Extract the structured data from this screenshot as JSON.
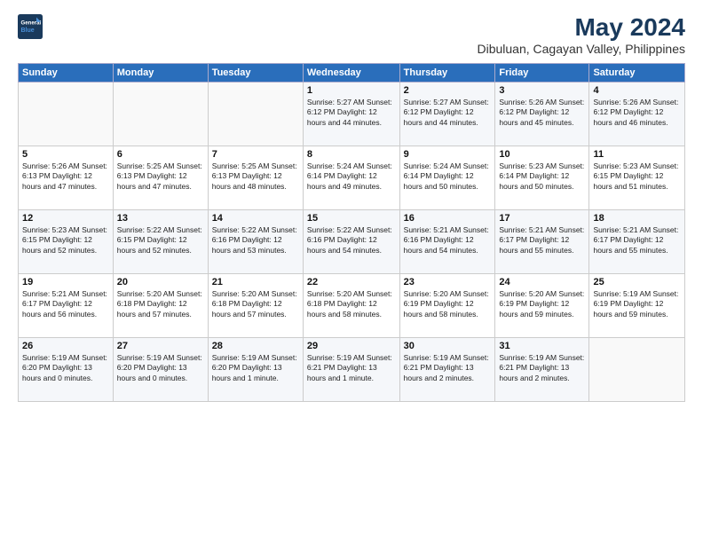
{
  "header": {
    "logo_line1": "General",
    "logo_line2": "Blue",
    "title": "May 2024",
    "subtitle": "Dibuluan, Cagayan Valley, Philippines"
  },
  "weekdays": [
    "Sunday",
    "Monday",
    "Tuesday",
    "Wednesday",
    "Thursday",
    "Friday",
    "Saturday"
  ],
  "weeks": [
    [
      {
        "day": "",
        "detail": ""
      },
      {
        "day": "",
        "detail": ""
      },
      {
        "day": "",
        "detail": ""
      },
      {
        "day": "1",
        "detail": "Sunrise: 5:27 AM\nSunset: 6:12 PM\nDaylight: 12 hours\nand 44 minutes."
      },
      {
        "day": "2",
        "detail": "Sunrise: 5:27 AM\nSunset: 6:12 PM\nDaylight: 12 hours\nand 44 minutes."
      },
      {
        "day": "3",
        "detail": "Sunrise: 5:26 AM\nSunset: 6:12 PM\nDaylight: 12 hours\nand 45 minutes."
      },
      {
        "day": "4",
        "detail": "Sunrise: 5:26 AM\nSunset: 6:12 PM\nDaylight: 12 hours\nand 46 minutes."
      }
    ],
    [
      {
        "day": "5",
        "detail": "Sunrise: 5:26 AM\nSunset: 6:13 PM\nDaylight: 12 hours\nand 47 minutes."
      },
      {
        "day": "6",
        "detail": "Sunrise: 5:25 AM\nSunset: 6:13 PM\nDaylight: 12 hours\nand 47 minutes."
      },
      {
        "day": "7",
        "detail": "Sunrise: 5:25 AM\nSunset: 6:13 PM\nDaylight: 12 hours\nand 48 minutes."
      },
      {
        "day": "8",
        "detail": "Sunrise: 5:24 AM\nSunset: 6:14 PM\nDaylight: 12 hours\nand 49 minutes."
      },
      {
        "day": "9",
        "detail": "Sunrise: 5:24 AM\nSunset: 6:14 PM\nDaylight: 12 hours\nand 50 minutes."
      },
      {
        "day": "10",
        "detail": "Sunrise: 5:23 AM\nSunset: 6:14 PM\nDaylight: 12 hours\nand 50 minutes."
      },
      {
        "day": "11",
        "detail": "Sunrise: 5:23 AM\nSunset: 6:15 PM\nDaylight: 12 hours\nand 51 minutes."
      }
    ],
    [
      {
        "day": "12",
        "detail": "Sunrise: 5:23 AM\nSunset: 6:15 PM\nDaylight: 12 hours\nand 52 minutes."
      },
      {
        "day": "13",
        "detail": "Sunrise: 5:22 AM\nSunset: 6:15 PM\nDaylight: 12 hours\nand 52 minutes."
      },
      {
        "day": "14",
        "detail": "Sunrise: 5:22 AM\nSunset: 6:16 PM\nDaylight: 12 hours\nand 53 minutes."
      },
      {
        "day": "15",
        "detail": "Sunrise: 5:22 AM\nSunset: 6:16 PM\nDaylight: 12 hours\nand 54 minutes."
      },
      {
        "day": "16",
        "detail": "Sunrise: 5:21 AM\nSunset: 6:16 PM\nDaylight: 12 hours\nand 54 minutes."
      },
      {
        "day": "17",
        "detail": "Sunrise: 5:21 AM\nSunset: 6:17 PM\nDaylight: 12 hours\nand 55 minutes."
      },
      {
        "day": "18",
        "detail": "Sunrise: 5:21 AM\nSunset: 6:17 PM\nDaylight: 12 hours\nand 55 minutes."
      }
    ],
    [
      {
        "day": "19",
        "detail": "Sunrise: 5:21 AM\nSunset: 6:17 PM\nDaylight: 12 hours\nand 56 minutes."
      },
      {
        "day": "20",
        "detail": "Sunrise: 5:20 AM\nSunset: 6:18 PM\nDaylight: 12 hours\nand 57 minutes."
      },
      {
        "day": "21",
        "detail": "Sunrise: 5:20 AM\nSunset: 6:18 PM\nDaylight: 12 hours\nand 57 minutes."
      },
      {
        "day": "22",
        "detail": "Sunrise: 5:20 AM\nSunset: 6:18 PM\nDaylight: 12 hours\nand 58 minutes."
      },
      {
        "day": "23",
        "detail": "Sunrise: 5:20 AM\nSunset: 6:19 PM\nDaylight: 12 hours\nand 58 minutes."
      },
      {
        "day": "24",
        "detail": "Sunrise: 5:20 AM\nSunset: 6:19 PM\nDaylight: 12 hours\nand 59 minutes."
      },
      {
        "day": "25",
        "detail": "Sunrise: 5:19 AM\nSunset: 6:19 PM\nDaylight: 12 hours\nand 59 minutes."
      }
    ],
    [
      {
        "day": "26",
        "detail": "Sunrise: 5:19 AM\nSunset: 6:20 PM\nDaylight: 13 hours\nand 0 minutes."
      },
      {
        "day": "27",
        "detail": "Sunrise: 5:19 AM\nSunset: 6:20 PM\nDaylight: 13 hours\nand 0 minutes."
      },
      {
        "day": "28",
        "detail": "Sunrise: 5:19 AM\nSunset: 6:20 PM\nDaylight: 13 hours\nand 1 minute."
      },
      {
        "day": "29",
        "detail": "Sunrise: 5:19 AM\nSunset: 6:21 PM\nDaylight: 13 hours\nand 1 minute."
      },
      {
        "day": "30",
        "detail": "Sunrise: 5:19 AM\nSunset: 6:21 PM\nDaylight: 13 hours\nand 2 minutes."
      },
      {
        "day": "31",
        "detail": "Sunrise: 5:19 AM\nSunset: 6:21 PM\nDaylight: 13 hours\nand 2 minutes."
      },
      {
        "day": "",
        "detail": ""
      }
    ]
  ]
}
